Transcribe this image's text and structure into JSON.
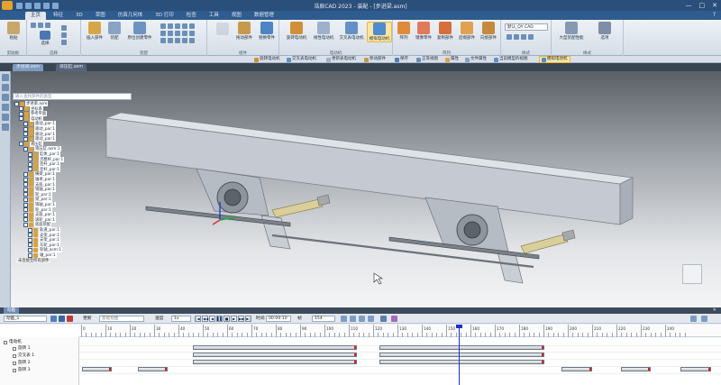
{
  "window": {
    "title": "浩辰CAD 2023 - 装配 - [步进梁.asm]",
    "controls": [
      "—",
      "□",
      "✕"
    ]
  },
  "menu": {
    "tabs": [
      "主页",
      "特征",
      "3D",
      "草图",
      "仿真几何体",
      "3D 打印",
      "检查",
      "工具",
      "视图",
      "数据管理"
    ],
    "active": "主页",
    "help": "?"
  },
  "ribbon": {
    "groups": [
      {
        "label": "剪贴板",
        "buttons": [
          "粘贴"
        ]
      },
      {
        "label": "选择",
        "buttons": [
          "选择"
        ]
      },
      {
        "label": "装配",
        "buttons": [
          "插入部件",
          "装配",
          "原位创建零件"
        ]
      },
      {
        "label": "组件",
        "buttons": [
          "拖动部件",
          "替换零件"
        ]
      },
      {
        "label": "电动机",
        "buttons": [
          "旋转电动机",
          "线性电动机",
          "交叉表电动机",
          "模拟电动机"
        ]
      },
      {
        "label": "阵列",
        "buttons": [
          "阵列",
          "镜像零件",
          "复制部件",
          "后缀部件",
          "向接部件"
        ]
      },
      {
        "label": "样式",
        "buttons": [
          "大型装配性能",
          "选项"
        ]
      }
    ],
    "style_combo": "默认_QY CAD",
    "style_group_label": "样式",
    "selected_button": "模拟电动机"
  },
  "toolbar2": {
    "items": [
      "旋转电动机",
      "交叉表电动机",
      "更新表电动机",
      "移动部件",
      "保存",
      "正等视图",
      "属性",
      "文件属性",
      "当前模型的视图",
      "模拟电动机"
    ],
    "selected": "模拟电动机"
  },
  "doc_tabs": [
    {
      "label": "步进梁.asm",
      "active": true
    },
    {
      "label": "液压缸.asm",
      "active": false
    }
  ],
  "tree": {
    "search_placeholder": "输入查找部件的类型",
    "nodes": [
      "步进梁.asm",
      "坐标系",
      "参考平面",
      "电动机",
      "驱动_par:1",
      "驱动_par:1",
      "驱动_par:1",
      "驱动_par:1",
      "液压缸",
      "液压缸.asm:1",
      "缸体_par:1",
      "活塞杆_par:1",
      "连杆_par:1",
      "连杆_par:1",
      "横梁_par:1",
      "轴承_par:1",
      "支座_par:1",
      "销轴_par:1",
      "轮_par:1",
      "梁_par:1",
      "销轴_par:1",
      "轮_par:1",
      "支座_par:1",
      "滚轮_par:1",
      "底座装配",
      "轨道_par:1",
      "支架_par:1",
      "支架_par:1",
      "车轮_par:1",
      "轮轴_asm:1",
      "轴_par:1"
    ],
    "bottom_tag": "未连接至所有部件"
  },
  "lower_panel": {
    "tab": "动画",
    "close": "✕",
    "anim_select": "动画_1",
    "update_label": "更新",
    "update_value": "基础视图",
    "speed_label": "速度",
    "speed_value": "1x",
    "time_label": "时间",
    "time_value": "00:00:10",
    "frame_label": "帧",
    "frame_value": "154",
    "play_buttons": [
      "|◀",
      "◀◀",
      "◀",
      "▌▌",
      "■",
      "▶",
      "▶▶",
      "▶|"
    ]
  },
  "timeline": {
    "ticks": [
      "0",
      "10",
      "20",
      "30",
      "40",
      "50",
      "60",
      "70",
      "80",
      "90",
      "100",
      "110",
      "120",
      "130",
      "140",
      "150",
      "160",
      "170",
      "180",
      "190",
      "200",
      "210",
      "220",
      "230",
      "240"
    ],
    "tracks": [
      "电动机",
      "旋转 1",
      "交叉表 1",
      "旋转 2",
      "旋转 3"
    ],
    "playhead_frame": 154
  },
  "colors": {
    "title_bar": "#2a4f7a",
    "menu_bar": "#2f5c8f",
    "ribbon": "#e4e9ef",
    "playhead": "#1d2fd0",
    "bar_end": "#d02020",
    "beam": "#c5cad2"
  }
}
